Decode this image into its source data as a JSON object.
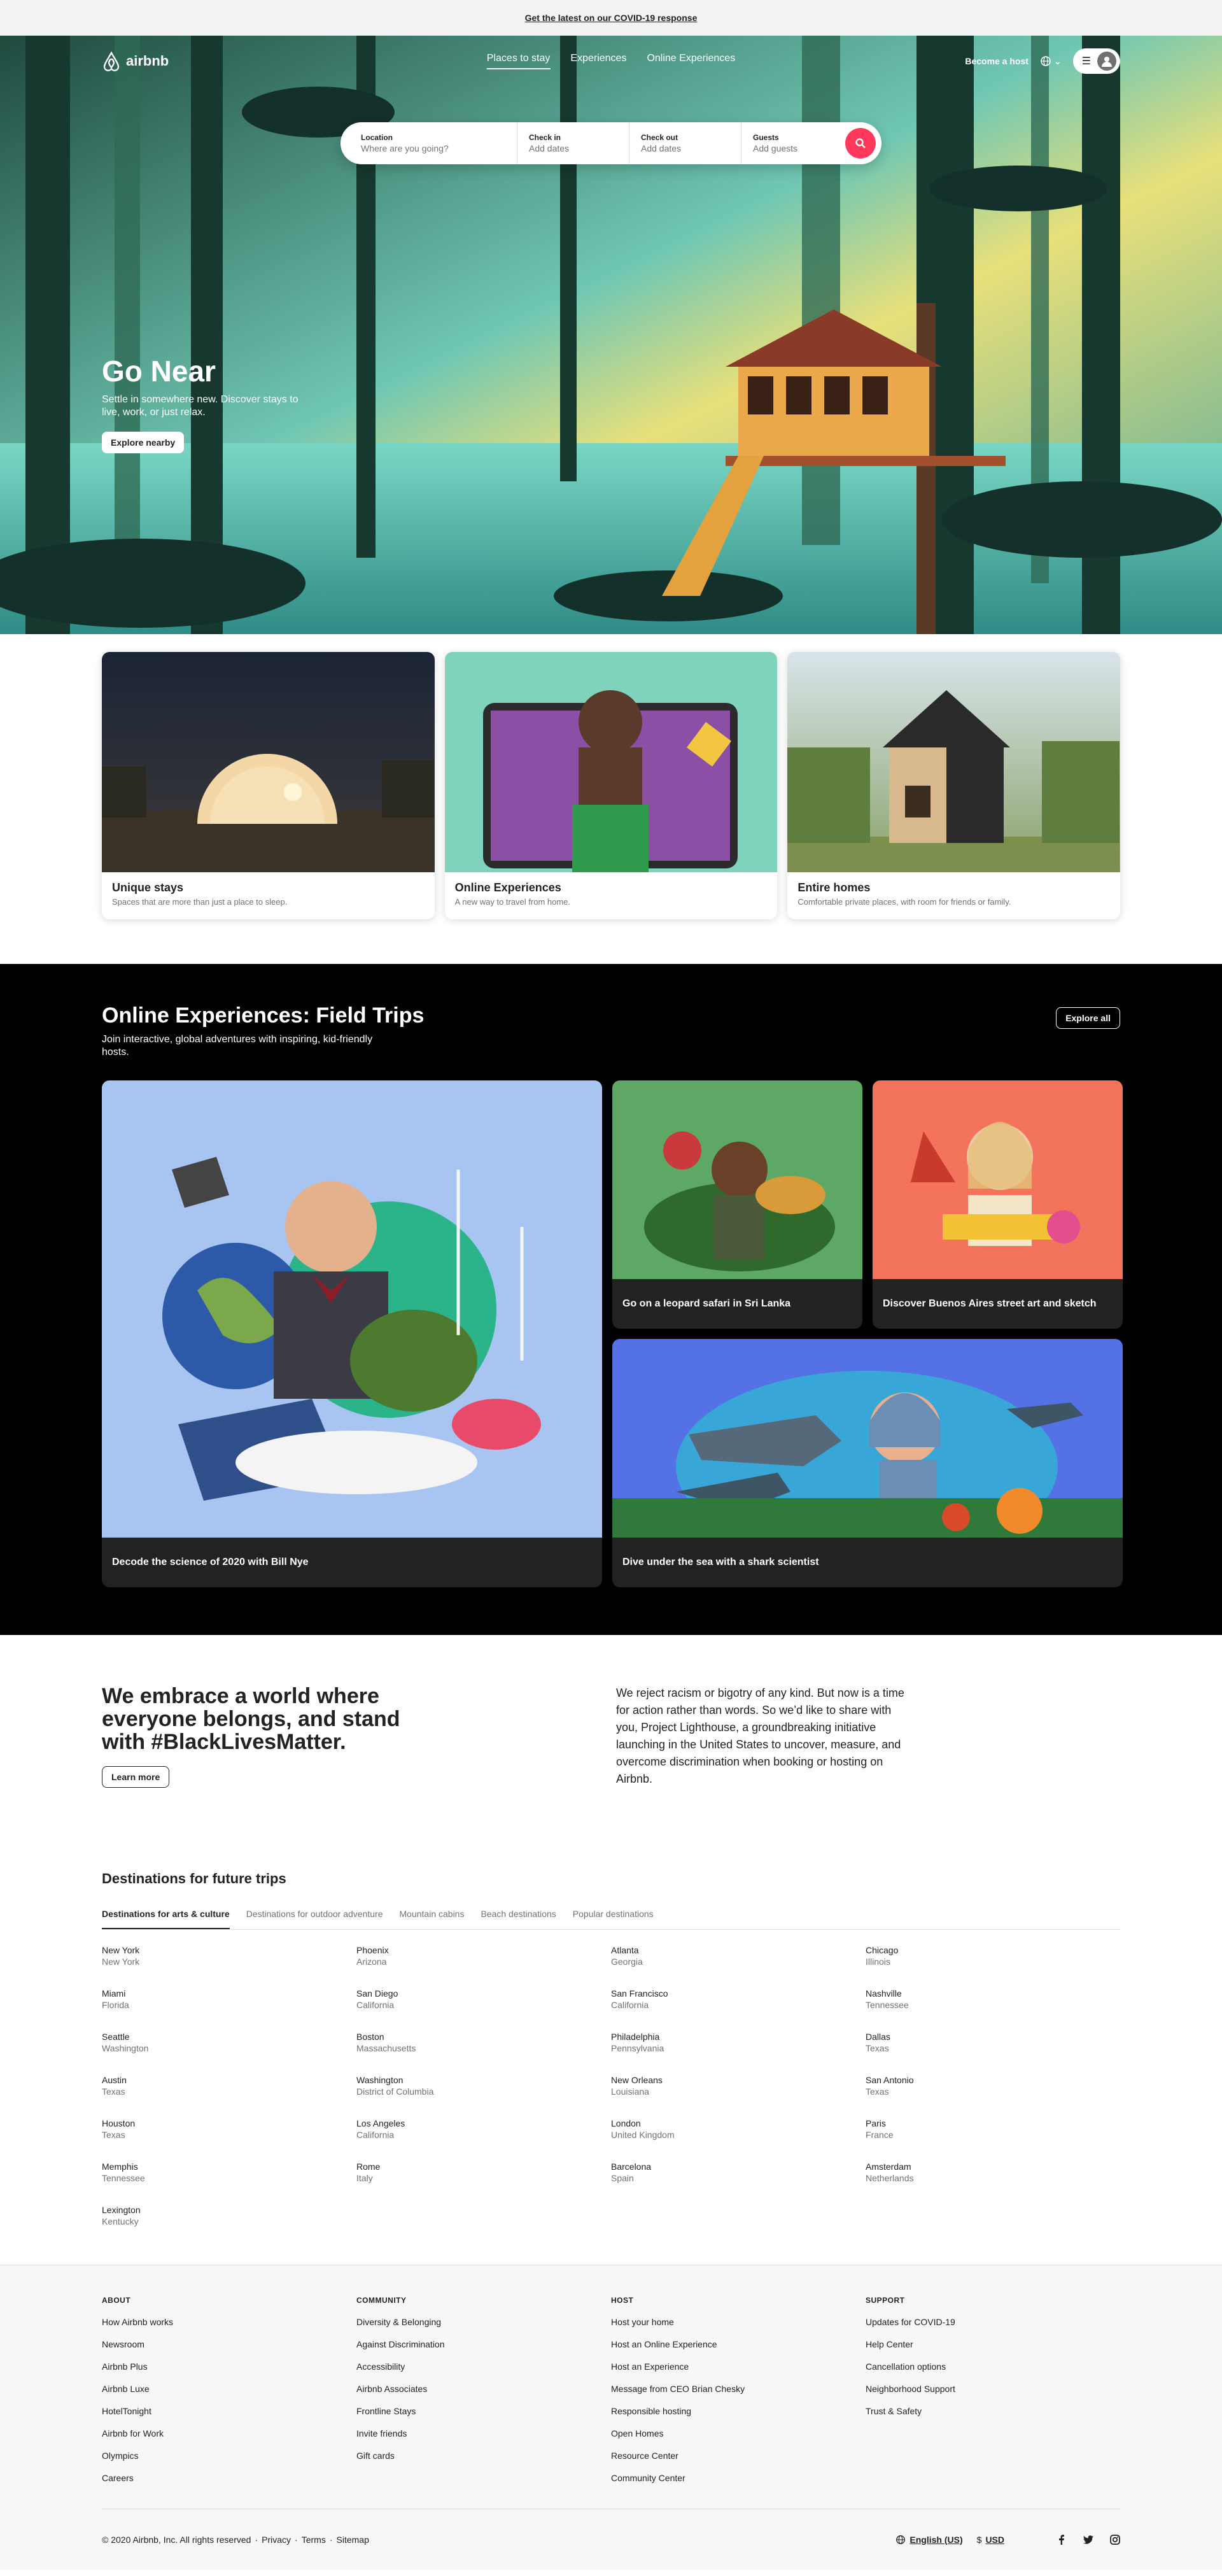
{
  "banner": {
    "link": "Get the latest on our COVID-19 response"
  },
  "header": {
    "logo_text": "airbnb",
    "nav": [
      "Places to stay",
      "Experiences",
      "Online Experiences"
    ],
    "become_host": "Become a host"
  },
  "search": {
    "location_label": "Location",
    "location_placeholder": "Where are you going?",
    "checkin_label": "Check in",
    "checkin_value": "Add dates",
    "checkout_label": "Check out",
    "checkout_value": "Add dates",
    "guests_label": "Guests",
    "guests_value": "Add guests"
  },
  "hero": {
    "title": "Go Near",
    "subtitle": "Settle in somewhere new. Discover stays to live, work, or just relax.",
    "button": "Explore nearby"
  },
  "cards": [
    {
      "title": "Unique stays",
      "subtitle": "Spaces that are more than just a place to sleep."
    },
    {
      "title": "Online Experiences",
      "subtitle": "A new way to travel from home."
    },
    {
      "title": "Entire homes",
      "subtitle": "Comfortable private places, with room for friends or family."
    }
  ],
  "field_trips": {
    "title": "Online Experiences: Field Trips",
    "subtitle": "Join interactive, global adventures with inspiring, kid-friendly hosts.",
    "button": "Explore all",
    "items": [
      "Decode the science of 2020 with Bill Nye",
      "Go on a leopard safari in Sri Lanka",
      "Discover Buenos Aires street art and sketch",
      "Dive under the sea with a shark scientist"
    ]
  },
  "blm": {
    "title": "We embrace a world where everyone belongs, and stand with #BlackLivesMatter.",
    "button": "Learn more",
    "body": "We reject racism or bigotry of any kind. But now is a time for action rather than words. So we’d like to share with you, Project Lighthouse, a groundbreaking initiative launching in the United States to uncover, measure, and overcome discrimination when booking or hosting on Airbnb."
  },
  "destinations": {
    "title": "Destinations for future trips",
    "tabs": [
      "Destinations for arts & culture",
      "Destinations for outdoor adventure",
      "Mountain cabins",
      "Beach destinations",
      "Popular destinations"
    ],
    "items": [
      {
        "city": "New York",
        "region": "New York"
      },
      {
        "city": "Phoenix",
        "region": "Arizona"
      },
      {
        "city": "Atlanta",
        "region": "Georgia"
      },
      {
        "city": "Chicago",
        "region": "Illinois"
      },
      {
        "city": "Miami",
        "region": "Florida"
      },
      {
        "city": "San Diego",
        "region": "California"
      },
      {
        "city": "San Francisco",
        "region": "California"
      },
      {
        "city": "Nashville",
        "region": "Tennessee"
      },
      {
        "city": "Seattle",
        "region": "Washington"
      },
      {
        "city": "Boston",
        "region": "Massachusetts"
      },
      {
        "city": "Philadelphia",
        "region": "Pennsylvania"
      },
      {
        "city": "Dallas",
        "region": "Texas"
      },
      {
        "city": "Austin",
        "region": "Texas"
      },
      {
        "city": "Washington",
        "region": "District of Columbia"
      },
      {
        "city": "New Orleans",
        "region": "Louisiana"
      },
      {
        "city": "San Antonio",
        "region": "Texas"
      },
      {
        "city": "Houston",
        "region": "Texas"
      },
      {
        "city": "Los Angeles",
        "region": "California"
      },
      {
        "city": "London",
        "region": "United Kingdom"
      },
      {
        "city": "Paris",
        "region": "France"
      },
      {
        "city": "Memphis",
        "region": "Tennessee"
      },
      {
        "city": "Rome",
        "region": "Italy"
      },
      {
        "city": "Barcelona",
        "region": "Spain"
      },
      {
        "city": "Amsterdam",
        "region": "Netherlands"
      },
      {
        "city": "Lexington",
        "region": "Kentucky"
      }
    ]
  },
  "footer": {
    "columns": [
      {
        "title": "ABOUT",
        "items": [
          "How Airbnb works",
          "Newsroom",
          "Airbnb Plus",
          "Airbnb Luxe",
          "HotelTonight",
          "Airbnb for Work",
          "Olympics",
          "Careers"
        ]
      },
      {
        "title": "COMMUNITY",
        "items": [
          "Diversity & Belonging",
          "Against Discrimination",
          "Accessibility",
          "Airbnb Associates",
          "Frontline Stays",
          "Invite friends",
          "Gift cards"
        ]
      },
      {
        "title": "HOST",
        "items": [
          "Host your home",
          "Host an Online Experience",
          "Host an Experience",
          "Message from CEO Brian Chesky",
          "Responsible hosting",
          "Open Homes",
          "Resource Center",
          "Community Center"
        ]
      },
      {
        "title": "SUPPORT",
        "items": [
          "Updates for COVID-19",
          "Help Center",
          "Cancellation options",
          "Neighborhood Support",
          "Trust & Safety"
        ]
      }
    ],
    "copyright": "© 2020 Airbnb, Inc. All rights reserved",
    "links": [
      "Privacy",
      "Terms",
      "Sitemap"
    ],
    "language": "English (US)",
    "currency_symbol": "$",
    "currency": "USD"
  },
  "colors": {
    "brand": "#ff385c",
    "dark_bg": "#000000",
    "tile_bg": "#222222"
  }
}
